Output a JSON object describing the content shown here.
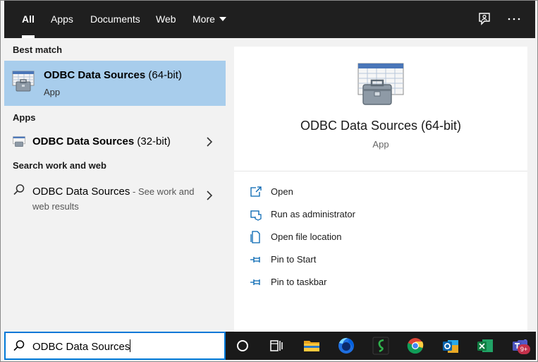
{
  "tabs": [
    {
      "label": "All",
      "active": true
    },
    {
      "label": "Apps",
      "active": false
    },
    {
      "label": "Documents",
      "active": false
    },
    {
      "label": "Web",
      "active": false
    },
    {
      "label": "More",
      "active": false
    }
  ],
  "top_icons": [
    "feedback-icon",
    "more-options-icon"
  ],
  "left": {
    "best_match_heading": "Best match",
    "best_match": {
      "title_bold": "ODBC Data Sources",
      "title_rest": " (64-bit)",
      "subtitle": "App",
      "icon": "odbc-app-icon"
    },
    "apps_heading": "Apps",
    "apps": [
      {
        "title_bold": "ODBC Data Sources",
        "title_rest": " (32-bit)",
        "icon": "odbc-app-icon"
      }
    ],
    "web_heading": "Search work and web",
    "web_result": {
      "query": "ODBC Data Sources",
      "suffix_line1": " - See work and",
      "suffix_line2": "web results",
      "icon": "search-icon"
    }
  },
  "preview": {
    "title": "ODBC Data Sources (64-bit)",
    "subtitle": "App",
    "actions": [
      {
        "label": "Open",
        "icon": "open-icon"
      },
      {
        "label": "Run as administrator",
        "icon": "run-as-admin-icon"
      },
      {
        "label": "Open file location",
        "icon": "file-location-icon"
      },
      {
        "label": "Pin to Start",
        "icon": "pin-icon"
      },
      {
        "label": "Pin to taskbar",
        "icon": "pin-icon"
      }
    ]
  },
  "search": {
    "value": "ODBC Data Sources",
    "icon": "search-icon"
  },
  "taskbar": {
    "items": [
      "cortana-icon",
      "task-view-icon",
      "file-explorer-icon",
      "firefox-icon",
      "app-icon",
      "chrome-icon",
      "outlook-icon",
      "excel-icon",
      "teams-icon"
    ],
    "teams_badge": "9+"
  },
  "colors": {
    "accent": "#0078d7",
    "selection": "#a8cdec",
    "topbar": "#1f1f1f",
    "taskbar": "#1a1a1a"
  }
}
